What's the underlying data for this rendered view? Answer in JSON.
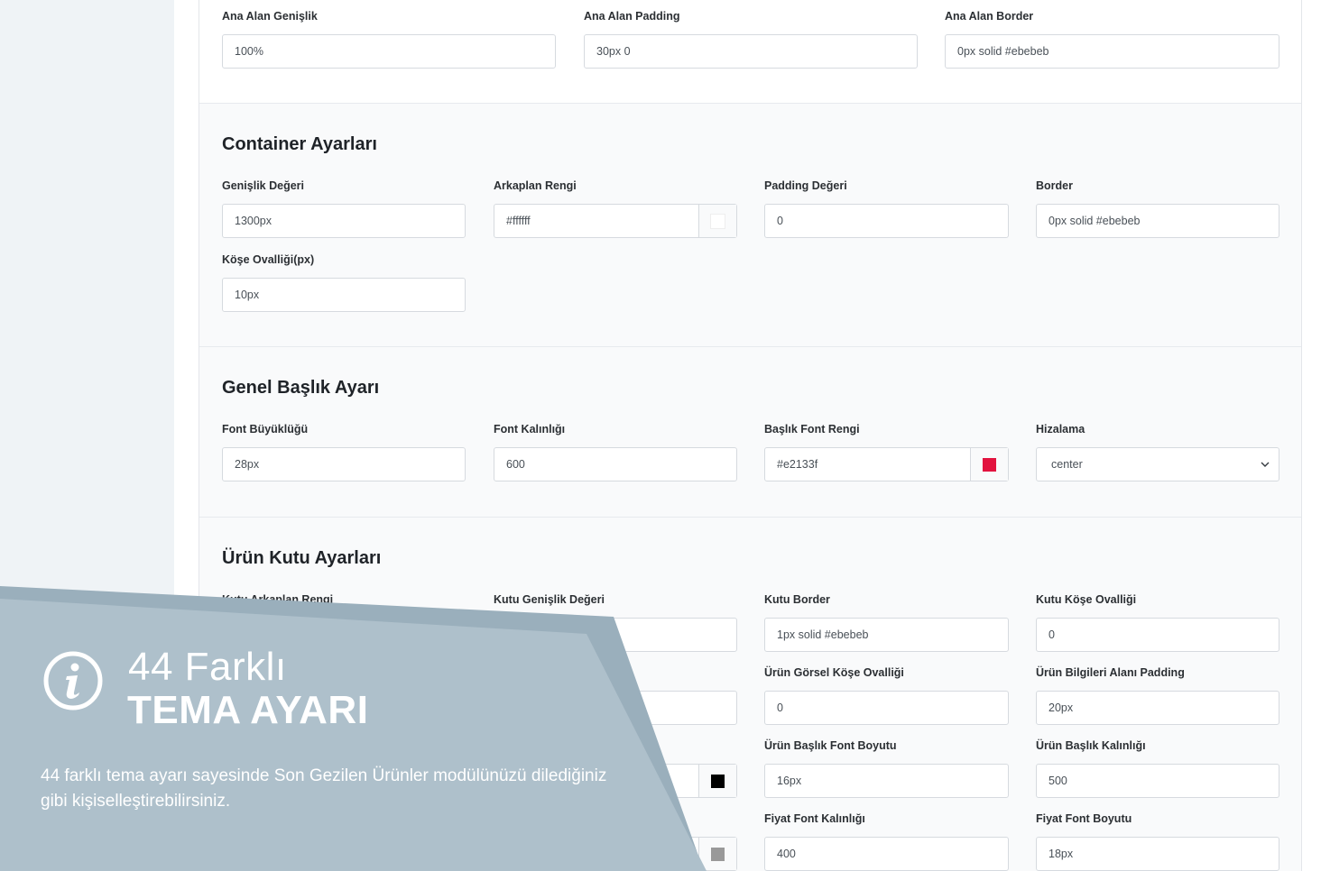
{
  "ana_alan": {
    "fields": [
      {
        "label": "Ana Alan Genişlik",
        "value": "100%"
      },
      {
        "label": "Ana Alan Padding",
        "value": "30px 0"
      },
      {
        "label": "Ana Alan Border",
        "value": "0px solid #ebebeb"
      }
    ]
  },
  "container": {
    "title": "Container Ayarları",
    "fields": [
      {
        "label": "Genişlik Değeri",
        "value": "1300px"
      },
      {
        "label": "Arkaplan Rengi",
        "value": "#ffffff",
        "swatch": "#ffffff"
      },
      {
        "label": "Padding Değeri",
        "value": "0"
      },
      {
        "label": "Border",
        "value": "0px solid #ebebeb"
      },
      {
        "label": "Köşe Ovalliği(px)",
        "value": "10px"
      }
    ]
  },
  "baslik": {
    "title": "Genel Başlık Ayarı",
    "fields": [
      {
        "label": "Font Büyüklüğü",
        "value": "28px"
      },
      {
        "label": "Font Kalınlığı",
        "value": "600"
      },
      {
        "label": "Başlık Font Rengi",
        "value": "#e2133f",
        "swatch": "#e2133f"
      },
      {
        "label": "Hizalama",
        "value": "center"
      }
    ]
  },
  "urun_kutu": {
    "title": "Ürün Kutu Ayarları",
    "fields": [
      {
        "label": "Kutu Arkaplan Rengi",
        "value": ""
      },
      {
        "label": "Kutu Genişlik Değeri",
        "value": ""
      },
      {
        "label": "Kutu Border",
        "value": "1px solid #ebebeb"
      },
      {
        "label": "Kutu Köşe Ovalliği",
        "value": "0"
      },
      {
        "label": "",
        "value": ""
      },
      {
        "label": "Ürün Görsel Köşe Ovalliği",
        "value": "0"
      },
      {
        "label": "Ürün Bilgileri Alanı Padding",
        "value": "20px"
      },
      {
        "label": "",
        "value": "",
        "swatch": "#000000"
      },
      {
        "label": "Ürün Başlık Font Boyutu",
        "value": "16px"
      },
      {
        "label": "Ürün Başlık Kalınlığı",
        "value": "500"
      },
      {
        "label": "",
        "value": "",
        "swatch": "#999999"
      },
      {
        "label": "Fiyat Font Kalınlığı",
        "value": "400"
      },
      {
        "label": "Fiyat Font Boyutu",
        "value": "18px"
      }
    ]
  },
  "banner": {
    "line1": "44 Farklı",
    "line2": "TEMA AYARI",
    "description": "44 farklı tema ayarı sayesinde Son Gezilen Ürünler modülünüzü dilediğiniz gibi kişiselleştirebilirsiniz.",
    "icon": "info-icon",
    "color": "#aec0cb"
  }
}
